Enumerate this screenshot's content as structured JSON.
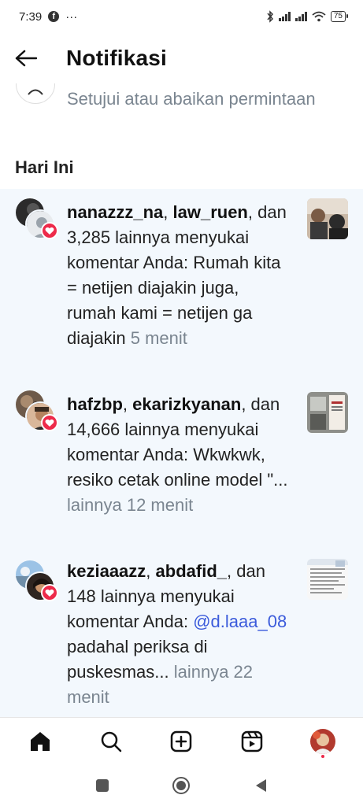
{
  "status_bar": {
    "time": "7:39",
    "app_badge": "f",
    "more": "···",
    "battery": "75"
  },
  "header": {
    "title": "Notifikasi"
  },
  "requests": {
    "subtitle": "Setujui atau abaikan permintaan"
  },
  "section": {
    "today": "Hari Ini"
  },
  "notifications": [
    {
      "user1": "nanazzz_na",
      "sep1": ", ",
      "user2": "law_ruen",
      "rest": ", dan 3,285 lainnya menyukai komentar Anda: Rumah kita = netijen diajakin juga, rumah kami = netijen ga diajakin ",
      "time": "5 menit"
    },
    {
      "user1": "hafzbp",
      "sep1": ", ",
      "user2": "ekarizkyanan",
      "rest": ", dan 14,666 lainnya menyukai komentar Anda: Wkwkwk, resiko cetak online model \"... ",
      "more_time": "lainnya 12 menit"
    },
    {
      "user1": "keziaaazz",
      "sep1": ", ",
      "user2": "abdafid_",
      "rest": ", dan 148 lainnya menyukai komentar Anda: ",
      "mention": "@d.laaa_08",
      "rest2": " padahal periksa di puskesmas... ",
      "more_time": "lainnya 22 menit"
    }
  ],
  "icons": {
    "back": "arrow-left",
    "heart": "heart",
    "home": "home",
    "search": "search",
    "create": "plus-square",
    "reels": "reels",
    "profile": "avatar"
  },
  "colors": {
    "accent_heart": "#ed2a4a",
    "mention": "#3b5bdb",
    "muted": "#7a8590",
    "list_bg": "#f3f8fd"
  }
}
